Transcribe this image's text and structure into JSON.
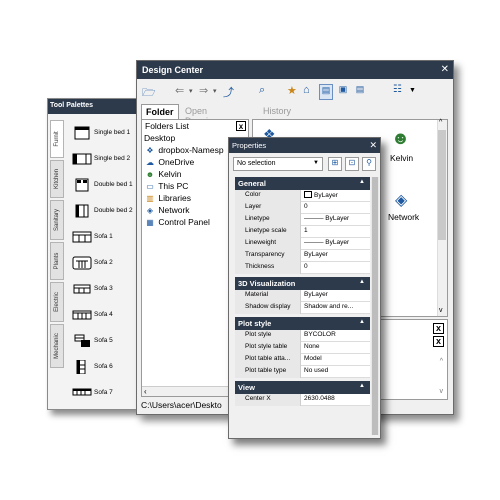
{
  "tool_palettes": {
    "title": "Tool Palettes",
    "tabs": [
      "Furnit",
      "Kitchen",
      "Sanitary",
      "Plants",
      "Electric",
      "Mechanic"
    ],
    "items": [
      {
        "label": "Single bed 1",
        "icon": "bed-single-icon"
      },
      {
        "label": "Single bed 2",
        "icon": "bed-single-icon"
      },
      {
        "label": "Double bed 1",
        "icon": "bed-double-icon"
      },
      {
        "label": "Double bed 2",
        "icon": "bed-double-icon"
      },
      {
        "label": "Sofa 1",
        "icon": "sofa-icon"
      },
      {
        "label": "Sofa 2",
        "icon": "sofa-icon"
      },
      {
        "label": "Sofa 3",
        "icon": "sofa-icon"
      },
      {
        "label": "Sofa 4",
        "icon": "sofa-icon"
      },
      {
        "label": "Sofa 5",
        "icon": "sofa-icon"
      },
      {
        "label": "Sofa 6",
        "icon": "sofa-icon"
      },
      {
        "label": "Sofa 7",
        "icon": "sofa-icon"
      }
    ]
  },
  "design_center": {
    "title": "Design Center",
    "close": "✕",
    "tabs": [
      "Folder",
      "Open Drawings",
      "History"
    ],
    "folders_list": {
      "header": "Folders List",
      "close": "x",
      "items": [
        {
          "label": "Desktop",
          "icon": ""
        },
        {
          "label": "dropbox-Namesp",
          "icon": "dropbox-icon"
        },
        {
          "label": "OneDrive",
          "icon": "cloud-icon"
        },
        {
          "label": "Kelvin",
          "icon": "user-icon"
        },
        {
          "label": "This PC",
          "icon": "computer-icon"
        },
        {
          "label": "Libraries",
          "icon": "library-icon"
        },
        {
          "label": "Network",
          "icon": "network-icon"
        },
        {
          "label": "Control Panel",
          "icon": "control-panel-icon"
        }
      ]
    },
    "content_items": [
      {
        "label": "Kelvin",
        "icon": "user-icon"
      },
      {
        "label": "Network",
        "icon": "network-icon"
      }
    ],
    "panel_close": "x",
    "path": "C:\\Users\\acer\\Deskto"
  },
  "properties": {
    "title": "Properties",
    "close": "✕",
    "selection": "No selection",
    "sections": [
      {
        "name": "General",
        "rows": [
          {
            "k": "Color",
            "v": "ByLayer"
          },
          {
            "k": "Layer",
            "v": "0"
          },
          {
            "k": "Linetype",
            "v": "——— ByLayer"
          },
          {
            "k": "Linetype scale",
            "v": "1"
          },
          {
            "k": "Lineweight",
            "v": "——— ByLayer"
          },
          {
            "k": "Transparency",
            "v": "ByLayer"
          },
          {
            "k": "Thickness",
            "v": "0"
          }
        ]
      },
      {
        "name": "3D Visualization",
        "rows": [
          {
            "k": "Material",
            "v": "ByLayer"
          },
          {
            "k": "Shadow display",
            "v": "Shadow and re..."
          }
        ]
      },
      {
        "name": "Plot style",
        "rows": [
          {
            "k": "Plot style",
            "v": "BYCOLOR"
          },
          {
            "k": "Plot style table",
            "v": "None"
          },
          {
            "k": "Plot table atta...",
            "v": "Model"
          },
          {
            "k": "Plot table type",
            "v": "No used"
          }
        ]
      },
      {
        "name": "View",
        "rows": [
          {
            "k": "Center X",
            "v": "2630.0488"
          }
        ]
      }
    ]
  },
  "colors": {
    "titlebar": "#2d3a4c",
    "icon_blue": "#1f5aa0"
  }
}
